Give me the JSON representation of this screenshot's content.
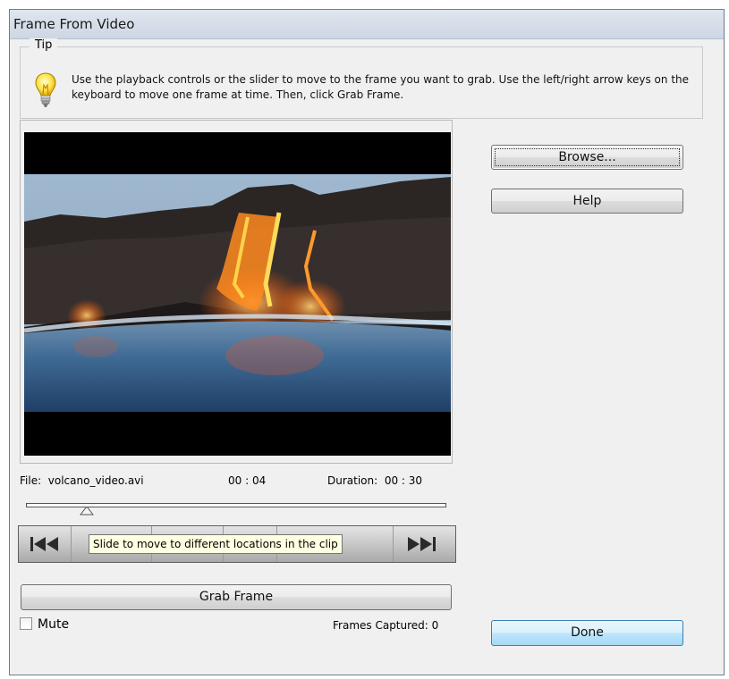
{
  "window": {
    "title": "Frame From Video"
  },
  "tip": {
    "legend": "Tip",
    "text": "Use the playback controls or the slider to move to the frame you want to grab. Use the left/right arrow keys on the keyboard to move one frame at time. Then, click Grab Frame."
  },
  "file": {
    "label": "File:",
    "name": "volcano_video.avi"
  },
  "playback": {
    "current_time": "00 : 04",
    "duration_label": "Duration:",
    "duration": "00 : 30",
    "position_fraction": 0.133
  },
  "tooltip": "Slide to move to different locations in the clip",
  "buttons": {
    "browse": "Browse...",
    "help": "Help",
    "grab": "Grab Frame",
    "done": "Done"
  },
  "mute": {
    "label": "Mute",
    "checked": false
  },
  "frames_captured": "Frames Captured: 0"
}
